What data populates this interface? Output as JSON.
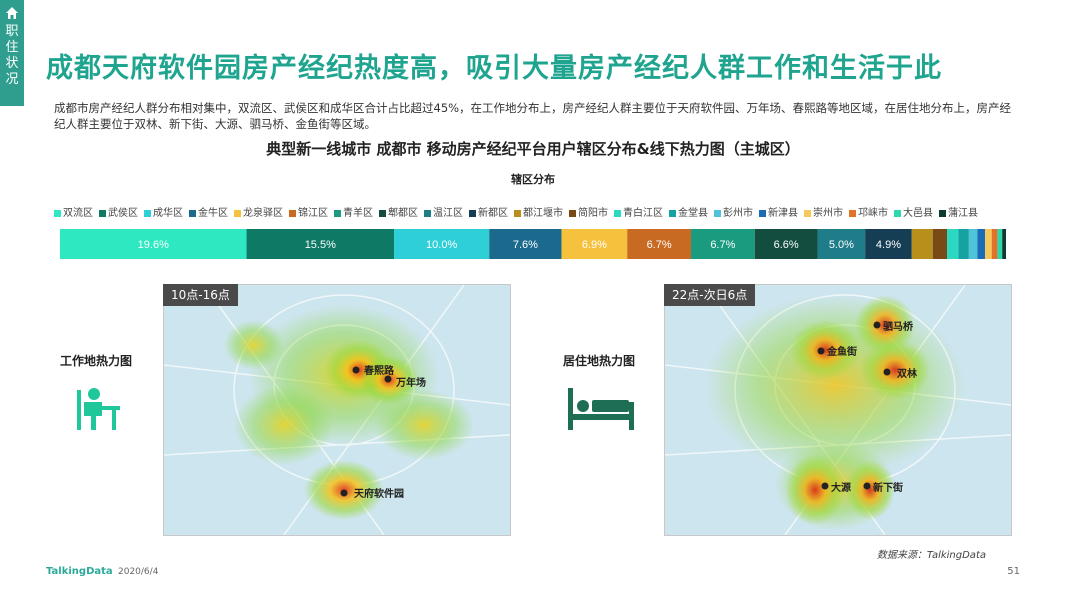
{
  "sidebar": {
    "section_label": "职住状况"
  },
  "title": "成都天府软件园房产经纪热度高，吸引大量房产经纪人群工作和生活于此",
  "description": "成都市房产经纪人群分布相对集中，双流区、武侯区和成华区合计占比超过45%，在工作地分布上，房产经纪人群主要位于天府软件园、万年场、春熙路等地区域，在居住地分布上，房产经纪人群主要位于双林、新下街、大源、驷马桥、金鱼街等区域。",
  "chart_title": "典型新一线城市  成都市  移动房产经纪平台用户辖区分布&线下热力图（主城区）",
  "chart_data": {
    "type": "bar",
    "subtitle": "辖区分布",
    "categories": [
      "双流区",
      "武侯区",
      "成华区",
      "金牛区",
      "龙泉驿区",
      "锦江区",
      "青羊区",
      "郫都区",
      "温江区",
      "新都区",
      "都江堰市",
      "简阳市",
      "青白江区",
      "金堂县",
      "彭州市",
      "新津县",
      "崇州市",
      "邛崃市",
      "大邑县",
      "蒲江县"
    ],
    "colors": [
      "#2de8c0",
      "#0e7a66",
      "#2fcfd8",
      "#1b6a8e",
      "#f6c23e",
      "#c96a22",
      "#1a9b7f",
      "#124d40",
      "#1f7d8a",
      "#153e55",
      "#b98f1c",
      "#7a4a16",
      "#2bd9c2",
      "#17a2a2",
      "#4fc3d9",
      "#1b6cb5",
      "#f5c85a",
      "#e0722a",
      "#2fd7ad",
      "#0e3b2f"
    ],
    "values": [
      19.6,
      15.5,
      10.0,
      7.6,
      6.9,
      6.7,
      6.7,
      6.6,
      5.0,
      4.9,
      2.2,
      1.5,
      1.2,
      1.1,
      0.9,
      0.8,
      0.7,
      0.6,
      0.5,
      0.4
    ],
    "labels": [
      "19.6%",
      "15.5%",
      "10.0%",
      "7.6%",
      "6.9%",
      "6.7%",
      "6.7%",
      "6.6%",
      "5.0%",
      "4.9%"
    ]
  },
  "work_map": {
    "time_label": "10点-16点",
    "side_label": "工作地热力图",
    "pins": [
      "春熙路",
      "万年场",
      "天府软件园"
    ]
  },
  "home_map": {
    "time_label": "22点-次日6点",
    "side_label": "居住地热力图",
    "pins": [
      "驷马桥",
      "金鱼街",
      "双林",
      "大源",
      "新下街"
    ]
  },
  "source": "数据来源：TalkingData",
  "footer": {
    "brand": "TalkingData",
    "date": "2020/6/4",
    "page": "51"
  }
}
